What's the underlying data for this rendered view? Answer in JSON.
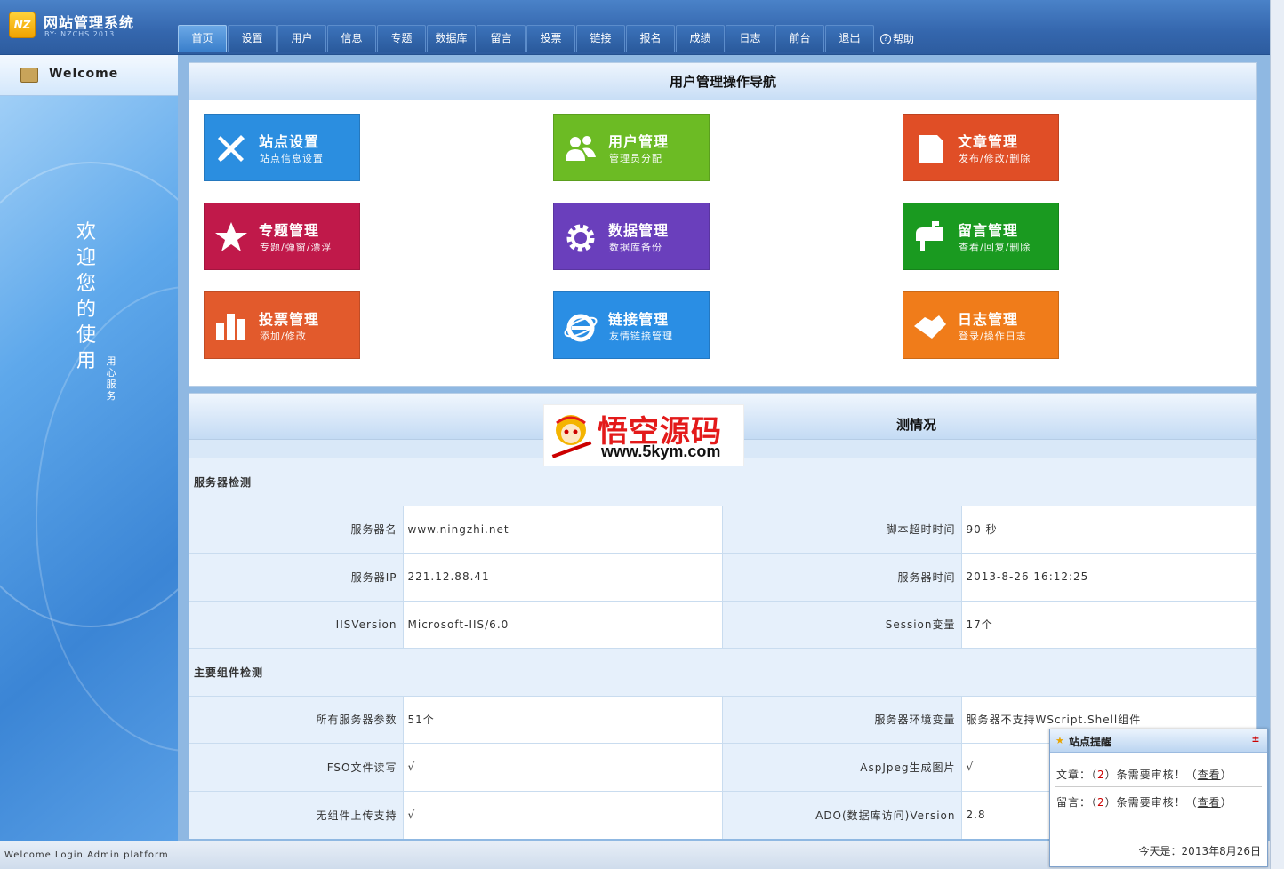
{
  "header": {
    "logo_mark": "NZ",
    "title": "网站管理系统",
    "subtitle": "BY: NZCHS.2013",
    "nav": [
      "首页",
      "设置",
      "用户",
      "信息",
      "专题",
      "数据库",
      "留言",
      "投票",
      "链接",
      "报名",
      "成绩",
      "日志",
      "前台",
      "退出"
    ],
    "help_label": "帮助"
  },
  "sidebar": {
    "welcome": "Welcome",
    "vertical_text": [
      "欢",
      "迎",
      "您",
      "的",
      "使",
      "用"
    ],
    "small_text": [
      "用",
      "心",
      "服",
      "务"
    ]
  },
  "nav_panel": {
    "title": "用户管理操作导航",
    "tiles": [
      {
        "title": "站点设置",
        "sub": "站点信息设置",
        "color": "#2b8ee0",
        "icon": "tools-icon"
      },
      {
        "title": "用户管理",
        "sub": "管理员分配",
        "color": "#6cbb24",
        "icon": "users-icon"
      },
      {
        "title": "文章管理",
        "sub": "发布/修改/删除",
        "color": "#e04e26",
        "icon": "document-icon"
      },
      {
        "title": "专题管理",
        "sub": "专题/弹窗/漂浮",
        "color": "#c0194a",
        "icon": "star-icon"
      },
      {
        "title": "数据管理",
        "sub": "数据库备份",
        "color": "#6a3fbc",
        "icon": "gear-icon"
      },
      {
        "title": "留言管理",
        "sub": "查看/回复/删除",
        "color": "#1a9a20",
        "icon": "mailbox-icon"
      },
      {
        "title": "投票管理",
        "sub": "添加/修改",
        "color": "#e25a2c",
        "icon": "bar-chart-icon"
      },
      {
        "title": "链接管理",
        "sub": "友情链接管理",
        "color": "#2a8ee4",
        "icon": "ie-icon"
      },
      {
        "title": "日志管理",
        "sub": "登录/操作日志",
        "color": "#f07c1a",
        "icon": "handshake-icon"
      }
    ]
  },
  "info_panel": {
    "title": "测情况",
    "watermark_cn": "悟空源码",
    "watermark_url": "www.5kym.com",
    "section1": "服务器检测",
    "section2": "主要组件检测",
    "rows1": [
      {
        "l1": "服务器名",
        "v1": "www.ningzhi.net",
        "l2": "脚本超时时间",
        "v2": "90 秒"
      },
      {
        "l1": "服务器IP",
        "v1": "221.12.88.41",
        "l2": "服务器时间",
        "v2": "2013-8-26 16:12:25"
      },
      {
        "l1": "IISVersion",
        "v1": "Microsoft-IIS/6.0",
        "l2": "Session变量",
        "v2": "17个"
      }
    ],
    "rows2": [
      {
        "l1": "所有服务器参数",
        "v1": "51个",
        "l2": "服务器环境变量",
        "v2": "服务器不支持WScript.Shell组件"
      },
      {
        "l1": "FSO文件读写",
        "v1": "√",
        "l2": "AspJpeg生成图片",
        "v2": "√"
      },
      {
        "l1": "无组件上传支持",
        "v1": "√",
        "l2": "ADO(数据库访问)Version",
        "v2": "2.8"
      }
    ]
  },
  "popup": {
    "title": "站点提醒",
    "close": "±",
    "line1_prefix": "文章：（",
    "line1_num": "2",
    "line1_mid": "）条需要审核！（",
    "line1_link": "查看",
    "line1_suffix": "）",
    "line2_prefix": "留言：（",
    "line2_num": "2",
    "line2_mid": "）条需要审核！（",
    "line2_link": "查看",
    "line2_suffix": "）",
    "date": "今天是：2013年8月26日"
  },
  "footer": {
    "text": "Welcome Login Admin platform"
  }
}
